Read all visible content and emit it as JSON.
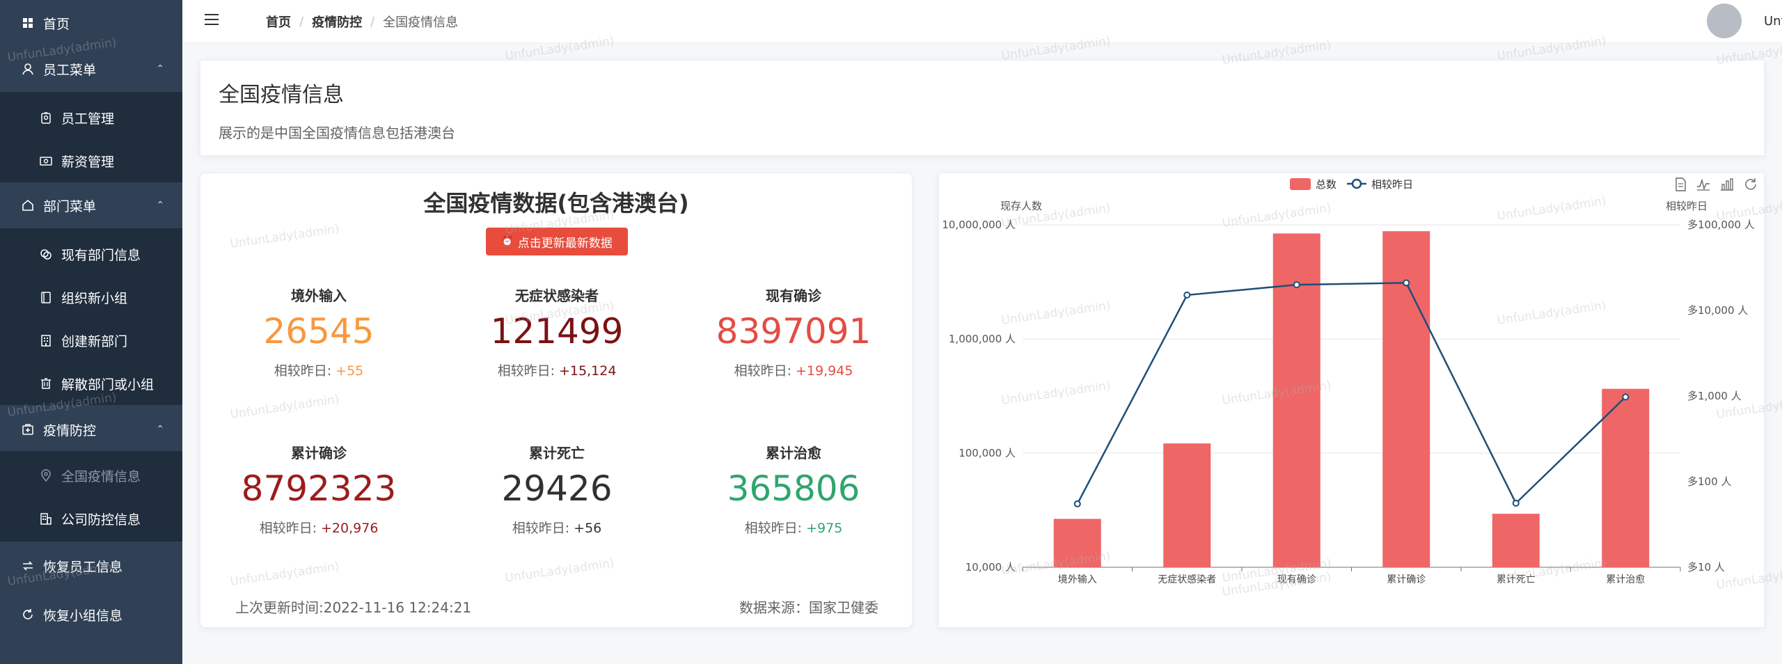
{
  "sidebar": {
    "items": [
      {
        "label": "首页",
        "icon": "dashboard-icon"
      },
      {
        "label": "员工菜单",
        "icon": "user-icon",
        "arrow": "⌃"
      },
      {
        "label": "员工管理",
        "icon": "badge-icon"
      },
      {
        "label": "薪资管理",
        "icon": "money-icon"
      },
      {
        "label": "部门菜单",
        "icon": "home-icon",
        "arrow": "⌃"
      },
      {
        "label": "现有部门信息",
        "icon": "layers-icon"
      },
      {
        "label": "组织新小组",
        "icon": "notebook-icon"
      },
      {
        "label": "创建新部门",
        "icon": "building-icon"
      },
      {
        "label": "解散部门或小组",
        "icon": "trash-icon"
      },
      {
        "label": "疫情防控",
        "icon": "first-aid-icon",
        "arrow": "⌃"
      },
      {
        "label": "全国疫情信息",
        "icon": "location-icon"
      },
      {
        "label": "公司防控信息",
        "icon": "office-icon"
      },
      {
        "label": "恢复员工信息",
        "icon": "restore-icon"
      },
      {
        "label": "恢复小组信息",
        "icon": "refresh-icon"
      }
    ]
  },
  "header": {
    "breadcrumb": [
      "首页",
      "疫情防控",
      "全国疫情信息"
    ],
    "separator": "/",
    "username": "UnfunLady",
    "chevron": "⌵"
  },
  "info": {
    "title": "全国疫情信息",
    "description": "展示的是中国全国疫情信息包括港澳台"
  },
  "stats": {
    "title": "全国疫情数据(包含港澳台)",
    "update_button": "点击更新最新数据",
    "delta_label": "相较昨日: ",
    "items": [
      {
        "label": "境外输入",
        "value": "26545",
        "delta": "+55",
        "color": "#f7983e"
      },
      {
        "label": "无症状感染者",
        "value": "121499",
        "delta": "+15,124",
        "color": "#7b1113"
      },
      {
        "label": "现有确诊",
        "value": "8397091",
        "delta": "+19,945",
        "color": "#e44c44"
      },
      {
        "label": "累计确诊",
        "value": "8792323",
        "delta": "+20,976",
        "color": "#9b1c1c"
      },
      {
        "label": "累计死亡",
        "value": "29426",
        "delta": "+56",
        "color": "#303133"
      },
      {
        "label": "累计治愈",
        "value": "365806",
        "delta": "+975",
        "color": "#2fa56e"
      }
    ],
    "last_update": "上次更新时间:2022-11-16 12:24:21",
    "source": "数据来源：国家卫健委"
  },
  "watermark": "UnfunLady(admin)",
  "chart_data": {
    "type": "bar",
    "categories": [
      "境外输入",
      "无症状感染者",
      "现有确诊",
      "累计确诊",
      "累计死亡",
      "累计治愈"
    ],
    "series": [
      {
        "name": "总数",
        "type": "bar",
        "values": [
          26545,
          121499,
          8397091,
          8792323,
          29426,
          365806
        ],
        "color": "#ee6666"
      },
      {
        "name": "相较昨日",
        "type": "line",
        "values": [
          55,
          15124,
          19945,
          20976,
          56,
          975
        ],
        "color": "#1f4e79"
      }
    ],
    "ylabel": "现存人数",
    "y2label": "相较昨日",
    "y_scale": "log",
    "ylim": [
      10000,
      10000000
    ],
    "y2lim": [
      10,
      100000
    ],
    "yticks": [
      "10,000 人",
      "100,000 人",
      "1,000,000 人",
      "10,000,000 人"
    ],
    "y2ticks": [
      "多10 人",
      "多100 人",
      "多1,000 人",
      "多10,000 人",
      "多100,000 人"
    ],
    "legend": "top-center"
  }
}
